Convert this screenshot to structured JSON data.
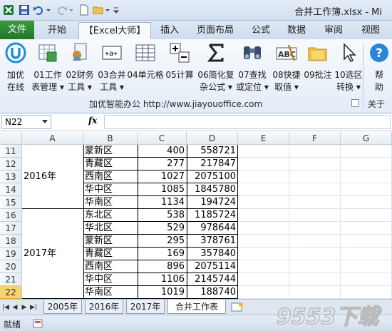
{
  "titlebar": {
    "title": "合并工作簿.xlsx - Mi"
  },
  "ribbon_tabs": [
    {
      "label": "文件"
    },
    {
      "label": "开始"
    },
    {
      "label": "【Excel大师】"
    },
    {
      "label": "插入"
    },
    {
      "label": "页面布局"
    },
    {
      "label": "公式"
    },
    {
      "label": "数据"
    },
    {
      "label": "审阅"
    },
    {
      "label": "视图"
    }
  ],
  "ribbon_buttons": [
    {
      "line1": "加优",
      "line2": "在线",
      "icon": "jiayou-online-icon"
    },
    {
      "line1": "01工作",
      "line2": "表管理 ▾",
      "icon": "sheet-manage-icon"
    },
    {
      "line1": "02财务",
      "line2": "工具 ▾",
      "icon": "finance-tools-icon"
    },
    {
      "line1": "03合并",
      "line2": "工具 ▾",
      "icon": "merge-tools-icon"
    },
    {
      "line1": "04单元格",
      "line2": "",
      "icon": "cell-grid-icon"
    },
    {
      "line1": "05计算",
      "line2": "",
      "icon": "plus-minus-icon"
    },
    {
      "line1": "06简化复",
      "line2": "杂公式 ▾",
      "icon": "sigma-icon"
    },
    {
      "line1": "07查找",
      "line2": "或定位 ▾",
      "icon": "binoculars-icon"
    },
    {
      "line1": "08快捷",
      "line2": "取值 ▾",
      "icon": "abc-value-icon"
    },
    {
      "line1": "09批注",
      "line2": "",
      "icon": "comment-folder-icon"
    },
    {
      "line1": "10选区",
      "line2": "转换 ▾",
      "icon": "cursor-icon"
    },
    {
      "line1": "帮",
      "line2": "助",
      "icon": "help-icon"
    }
  ],
  "ribbon_group": {
    "label": "加优智能办公  http://www.jiayouoffice.com",
    "about": "关于"
  },
  "formula_bar": {
    "name_box": "N22",
    "fx": "fx",
    "formula": ""
  },
  "columns": [
    "A",
    "B",
    "C",
    "D",
    "E",
    "F",
    "G"
  ],
  "rows": [
    {
      "num": "11",
      "region": "蒙新区",
      "count": "400",
      "amount": "558721"
    },
    {
      "num": "12",
      "region": "青藏区",
      "count": "277",
      "amount": "217847"
    },
    {
      "num": "13",
      "region": "西南区",
      "count": "1027",
      "amount": "2075100"
    },
    {
      "num": "14",
      "region": "华中区",
      "count": "1085",
      "amount": "1845780"
    },
    {
      "num": "15",
      "region": "华南区",
      "count": "1134",
      "amount": "194724"
    },
    {
      "num": "16",
      "region": "东北区",
      "count": "538",
      "amount": "1185724"
    },
    {
      "num": "17",
      "region": "华北区",
      "count": "529",
      "amount": "978644"
    },
    {
      "num": "18",
      "region": "蒙新区",
      "count": "295",
      "amount": "378761"
    },
    {
      "num": "19",
      "region": "青藏区",
      "count": "169",
      "amount": "357840"
    },
    {
      "num": "20",
      "region": "西南区",
      "count": "896",
      "amount": "2075114"
    },
    {
      "num": "21",
      "region": "华中区",
      "count": "1106",
      "amount": "2145744"
    },
    {
      "num": "22",
      "region": "华南区",
      "count": "1019",
      "amount": "188740"
    }
  ],
  "year_labels": {
    "y2016": "2016年",
    "y2017": "2017年"
  },
  "sheet_tabs": [
    {
      "label": "2005年"
    },
    {
      "label": "2016年"
    },
    {
      "label": "2017年"
    },
    {
      "label": "合并工作表"
    }
  ],
  "status": {
    "ready": "就绪"
  },
  "watermark": {
    "text": "9553下载"
  }
}
